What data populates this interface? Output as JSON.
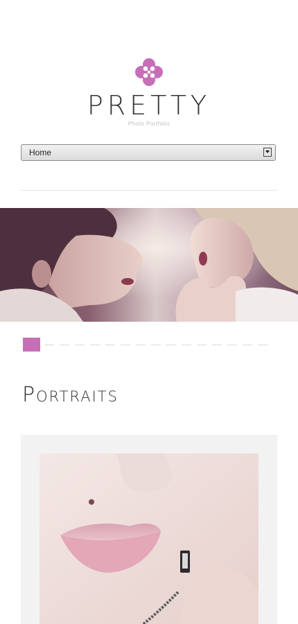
{
  "brand": {
    "title": "PRETTY",
    "subtitle": "Photo Portfolio",
    "accent_color": "#c66fb6",
    "logo_icon": "quatrefoil-icon"
  },
  "nav": {
    "selected": "Home"
  },
  "slider": {
    "active_index": 1,
    "total_slides": 16,
    "image": "hero-photo"
  },
  "portraits": {
    "heading": "Portraits",
    "image": "portrait-lips-photo"
  }
}
